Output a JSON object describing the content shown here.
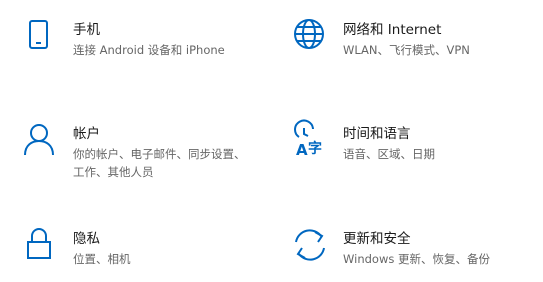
{
  "accent_color": "#0067c0",
  "tiles": [
    {
      "icon": "phone-icon",
      "title": "手机",
      "desc": "连接 Android 设备和 iPhone"
    },
    {
      "icon": "globe-icon",
      "title": "网络和 Internet",
      "desc": "WLAN、飞行模式、VPN"
    },
    {
      "icon": "person-icon",
      "title": "帐户",
      "desc": "你的帐户、电子邮件、同步设置、工作、其他人员"
    },
    {
      "icon": "language-icon",
      "title": "时间和语言",
      "desc": "语音、区域、日期"
    },
    {
      "icon": "lock-icon",
      "title": "隐私",
      "desc": "位置、相机"
    },
    {
      "icon": "sync-icon",
      "title": "更新和安全",
      "desc": "Windows 更新、恢复、备份"
    }
  ]
}
